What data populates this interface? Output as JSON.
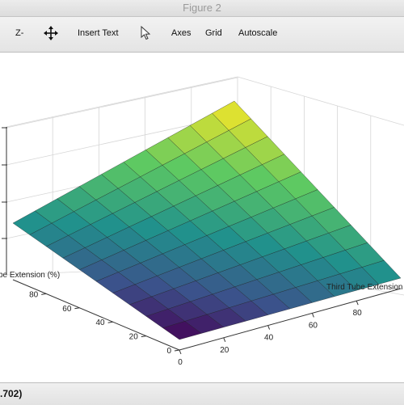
{
  "window": {
    "title": "Figure 2"
  },
  "toolbar": {
    "zoom_out_label": "Z-",
    "pan_icon": "pan-icon",
    "insert_text_label": "Insert Text",
    "pointer_icon": "pointer-icon",
    "axes_label": "Axes",
    "grid_label": "Grid",
    "autoscale_label": "Autoscale"
  },
  "status": {
    "text": ".702)"
  },
  "chart_data": {
    "type": "surface",
    "title": "",
    "xlabel": "Third Tube Extension",
    "ylabel": "be Extension (%)",
    "zlabel": "",
    "x_ticks": [
      0,
      20,
      40,
      60,
      80
    ],
    "y_ticks": [
      0,
      20,
      40,
      60,
      80
    ],
    "xlim": [
      0,
      100
    ],
    "ylim": [
      0,
      100
    ],
    "grid_steps": 10,
    "colormap": [
      "#440154",
      "#3b528b",
      "#21918c",
      "#5ec962",
      "#fde725"
    ],
    "grid": true
  }
}
